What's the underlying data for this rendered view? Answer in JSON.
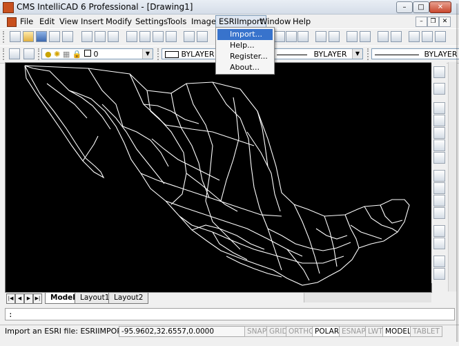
{
  "window": {
    "title": "CMS IntelliCAD 6 Professional - [Drawing1]",
    "minimize": "–",
    "maximize": "□",
    "close": "✕"
  },
  "menu": {
    "items": [
      "File",
      "Edit",
      "View",
      "Insert",
      "Modify",
      "Settings",
      "Tools",
      "Image",
      "ESRIImport",
      "Window",
      "Help"
    ],
    "active": "ESRIImport"
  },
  "dropdown": {
    "items": [
      "Import...",
      "Help...",
      "Register...",
      "About..."
    ],
    "highlighted": "Import..."
  },
  "toolbar2": {
    "layer_value": "0",
    "color_value": "BYLAYER",
    "linetype_value": "BYLAYER",
    "lineweight_value": "BYLAYER"
  },
  "tabs": [
    "Model",
    "Layout1",
    "Layout2"
  ],
  "command_line": ":",
  "status": {
    "message": "Import an ESRI file: ESRIIMPORT",
    "coords": "-95.9602,32.6557,0.0000",
    "toggles": [
      {
        "label": "SNAP",
        "on": false
      },
      {
        "label": "GRID",
        "on": false
      },
      {
        "label": "ORTHO",
        "on": false
      },
      {
        "label": "POLAR",
        "on": true
      },
      {
        "label": "ESNAP",
        "on": false
      },
      {
        "label": "LWT",
        "on": false
      },
      {
        "label": "MODEL",
        "on": true
      },
      {
        "label": "TABLET",
        "on": false
      }
    ]
  },
  "colors": {
    "canvas": "#000000",
    "map_lines": "#ffffff",
    "highlight": "#3873cc"
  }
}
